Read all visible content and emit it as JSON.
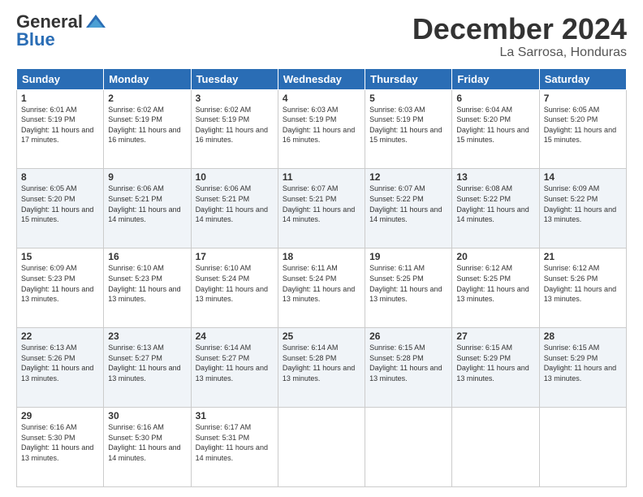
{
  "logo": {
    "general": "General",
    "blue": "Blue"
  },
  "header": {
    "month": "December 2024",
    "location": "La Sarrosa, Honduras"
  },
  "weekdays": [
    "Sunday",
    "Monday",
    "Tuesday",
    "Wednesday",
    "Thursday",
    "Friday",
    "Saturday"
  ],
  "weeks": [
    [
      {
        "day": "1",
        "sunrise": "Sunrise: 6:01 AM",
        "sunset": "Sunset: 5:19 PM",
        "daylight": "Daylight: 11 hours and 17 minutes."
      },
      {
        "day": "2",
        "sunrise": "Sunrise: 6:02 AM",
        "sunset": "Sunset: 5:19 PM",
        "daylight": "Daylight: 11 hours and 16 minutes."
      },
      {
        "day": "3",
        "sunrise": "Sunrise: 6:02 AM",
        "sunset": "Sunset: 5:19 PM",
        "daylight": "Daylight: 11 hours and 16 minutes."
      },
      {
        "day": "4",
        "sunrise": "Sunrise: 6:03 AM",
        "sunset": "Sunset: 5:19 PM",
        "daylight": "Daylight: 11 hours and 16 minutes."
      },
      {
        "day": "5",
        "sunrise": "Sunrise: 6:03 AM",
        "sunset": "Sunset: 5:19 PM",
        "daylight": "Daylight: 11 hours and 15 minutes."
      },
      {
        "day": "6",
        "sunrise": "Sunrise: 6:04 AM",
        "sunset": "Sunset: 5:20 PM",
        "daylight": "Daylight: 11 hours and 15 minutes."
      },
      {
        "day": "7",
        "sunrise": "Sunrise: 6:05 AM",
        "sunset": "Sunset: 5:20 PM",
        "daylight": "Daylight: 11 hours and 15 minutes."
      }
    ],
    [
      {
        "day": "8",
        "sunrise": "Sunrise: 6:05 AM",
        "sunset": "Sunset: 5:20 PM",
        "daylight": "Daylight: 11 hours and 15 minutes."
      },
      {
        "day": "9",
        "sunrise": "Sunrise: 6:06 AM",
        "sunset": "Sunset: 5:21 PM",
        "daylight": "Daylight: 11 hours and 14 minutes."
      },
      {
        "day": "10",
        "sunrise": "Sunrise: 6:06 AM",
        "sunset": "Sunset: 5:21 PM",
        "daylight": "Daylight: 11 hours and 14 minutes."
      },
      {
        "day": "11",
        "sunrise": "Sunrise: 6:07 AM",
        "sunset": "Sunset: 5:21 PM",
        "daylight": "Daylight: 11 hours and 14 minutes."
      },
      {
        "day": "12",
        "sunrise": "Sunrise: 6:07 AM",
        "sunset": "Sunset: 5:22 PM",
        "daylight": "Daylight: 11 hours and 14 minutes."
      },
      {
        "day": "13",
        "sunrise": "Sunrise: 6:08 AM",
        "sunset": "Sunset: 5:22 PM",
        "daylight": "Daylight: 11 hours and 14 minutes."
      },
      {
        "day": "14",
        "sunrise": "Sunrise: 6:09 AM",
        "sunset": "Sunset: 5:22 PM",
        "daylight": "Daylight: 11 hours and 13 minutes."
      }
    ],
    [
      {
        "day": "15",
        "sunrise": "Sunrise: 6:09 AM",
        "sunset": "Sunset: 5:23 PM",
        "daylight": "Daylight: 11 hours and 13 minutes."
      },
      {
        "day": "16",
        "sunrise": "Sunrise: 6:10 AM",
        "sunset": "Sunset: 5:23 PM",
        "daylight": "Daylight: 11 hours and 13 minutes."
      },
      {
        "day": "17",
        "sunrise": "Sunrise: 6:10 AM",
        "sunset": "Sunset: 5:24 PM",
        "daylight": "Daylight: 11 hours and 13 minutes."
      },
      {
        "day": "18",
        "sunrise": "Sunrise: 6:11 AM",
        "sunset": "Sunset: 5:24 PM",
        "daylight": "Daylight: 11 hours and 13 minutes."
      },
      {
        "day": "19",
        "sunrise": "Sunrise: 6:11 AM",
        "sunset": "Sunset: 5:25 PM",
        "daylight": "Daylight: 11 hours and 13 minutes."
      },
      {
        "day": "20",
        "sunrise": "Sunrise: 6:12 AM",
        "sunset": "Sunset: 5:25 PM",
        "daylight": "Daylight: 11 hours and 13 minutes."
      },
      {
        "day": "21",
        "sunrise": "Sunrise: 6:12 AM",
        "sunset": "Sunset: 5:26 PM",
        "daylight": "Daylight: 11 hours and 13 minutes."
      }
    ],
    [
      {
        "day": "22",
        "sunrise": "Sunrise: 6:13 AM",
        "sunset": "Sunset: 5:26 PM",
        "daylight": "Daylight: 11 hours and 13 minutes."
      },
      {
        "day": "23",
        "sunrise": "Sunrise: 6:13 AM",
        "sunset": "Sunset: 5:27 PM",
        "daylight": "Daylight: 11 hours and 13 minutes."
      },
      {
        "day": "24",
        "sunrise": "Sunrise: 6:14 AM",
        "sunset": "Sunset: 5:27 PM",
        "daylight": "Daylight: 11 hours and 13 minutes."
      },
      {
        "day": "25",
        "sunrise": "Sunrise: 6:14 AM",
        "sunset": "Sunset: 5:28 PM",
        "daylight": "Daylight: 11 hours and 13 minutes."
      },
      {
        "day": "26",
        "sunrise": "Sunrise: 6:15 AM",
        "sunset": "Sunset: 5:28 PM",
        "daylight": "Daylight: 11 hours and 13 minutes."
      },
      {
        "day": "27",
        "sunrise": "Sunrise: 6:15 AM",
        "sunset": "Sunset: 5:29 PM",
        "daylight": "Daylight: 11 hours and 13 minutes."
      },
      {
        "day": "28",
        "sunrise": "Sunrise: 6:15 AM",
        "sunset": "Sunset: 5:29 PM",
        "daylight": "Daylight: 11 hours and 13 minutes."
      }
    ],
    [
      {
        "day": "29",
        "sunrise": "Sunrise: 6:16 AM",
        "sunset": "Sunset: 5:30 PM",
        "daylight": "Daylight: 11 hours and 13 minutes."
      },
      {
        "day": "30",
        "sunrise": "Sunrise: 6:16 AM",
        "sunset": "Sunset: 5:30 PM",
        "daylight": "Daylight: 11 hours and 14 minutes."
      },
      {
        "day": "31",
        "sunrise": "Sunrise: 6:17 AM",
        "sunset": "Sunset: 5:31 PM",
        "daylight": "Daylight: 11 hours and 14 minutes."
      },
      null,
      null,
      null,
      null
    ]
  ]
}
